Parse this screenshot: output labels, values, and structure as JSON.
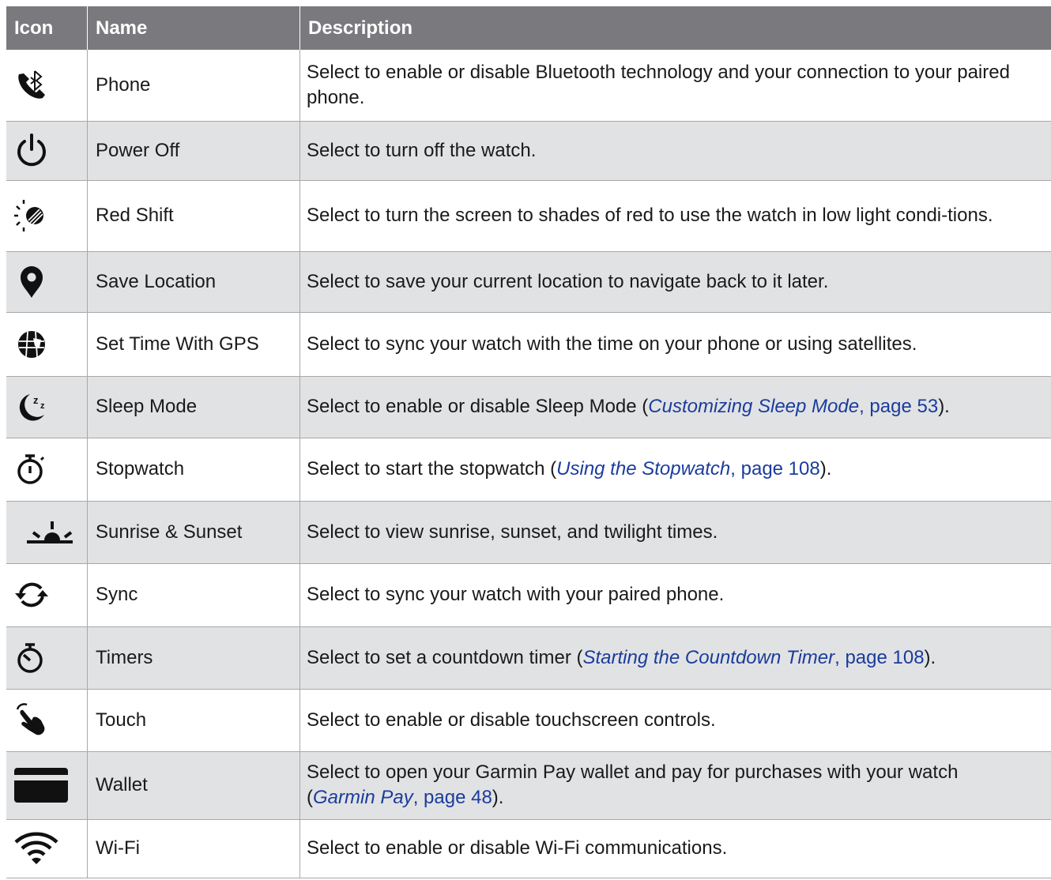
{
  "header": {
    "icon": "Icon",
    "name": "Name",
    "description": "Description"
  },
  "rows": [
    {
      "icon": "phone-bluetooth-icon",
      "name": "Phone",
      "desc": "Select to enable or disable Bluetooth technology and your connection to your paired phone."
    },
    {
      "icon": "power-icon",
      "name": "Power Off",
      "desc": "Select to turn off the watch."
    },
    {
      "icon": "red-shift-icon",
      "name": "Red Shift",
      "desc": "Select to turn the screen to shades of red to use the watch in low light condi-tions."
    },
    {
      "icon": "location-pin-icon",
      "name": "Save Location",
      "desc": "Select to save your current location to navigate back to it later."
    },
    {
      "icon": "globe-icon",
      "name": "Set Time With GPS",
      "desc": "Select to sync your watch with the time on your phone or using satellites."
    },
    {
      "icon": "sleep-moon-icon",
      "name": "Sleep Mode",
      "desc_pre": "Select to enable or disable Sleep Mode (",
      "link_title": "Customizing Sleep Mode",
      "link_page": ", page 53",
      "desc_post": ")."
    },
    {
      "icon": "stopwatch-icon",
      "name": "Stopwatch",
      "desc_pre": "Select to start the stopwatch (",
      "link_title": "Using the Stopwatch",
      "link_page": ", page 108",
      "desc_post": ")."
    },
    {
      "icon": "sunrise-icon",
      "name": "Sunrise & Sunset",
      "desc": "Select to view sunrise, sunset, and twilight times."
    },
    {
      "icon": "sync-icon",
      "name": "Sync",
      "desc": "Select to sync your watch with your paired phone."
    },
    {
      "icon": "timer-icon",
      "name": "Timers",
      "desc_pre": "Select to set a countdown timer (",
      "link_title": "Starting the Countdown Timer",
      "link_page": ", page 108",
      "desc_post": ")."
    },
    {
      "icon": "touch-hand-icon",
      "name": "Touch",
      "desc": "Select to enable or disable touchscreen controls."
    },
    {
      "icon": "wallet-card-icon",
      "name": "Wallet",
      "desc_pre": "Select to open your Garmin Pay wallet and pay for purchases with your watch (",
      "link_title": "Garmin Pay",
      "link_page": ", page 48",
      "desc_post": ")."
    },
    {
      "icon": "wifi-icon",
      "name": "Wi-Fi",
      "desc": "Select to enable or disable Wi-Fi communications."
    }
  ]
}
